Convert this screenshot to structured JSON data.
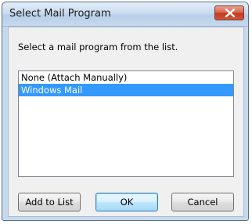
{
  "window": {
    "title": "Select Mail Program",
    "close_icon": "close-icon"
  },
  "dialog": {
    "instruction": "Select a mail program from the list.",
    "list": {
      "items": [
        {
          "label": "None (Attach Manually)",
          "selected": false
        },
        {
          "label": "Windows Mail",
          "selected": true
        }
      ]
    },
    "buttons": {
      "add_to_list": "Add to List",
      "ok": "OK",
      "cancel": "Cancel"
    }
  },
  "colors": {
    "selection": "#3399ff",
    "close_button": "#c2391d"
  }
}
